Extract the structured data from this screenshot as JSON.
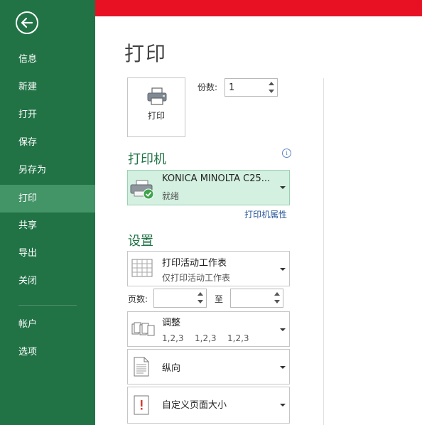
{
  "sidebar": {
    "items": [
      {
        "label": "信息"
      },
      {
        "label": "新建"
      },
      {
        "label": "打开"
      },
      {
        "label": "保存"
      },
      {
        "label": "另存为"
      },
      {
        "label": "打印"
      },
      {
        "label": "共享"
      },
      {
        "label": "导出"
      },
      {
        "label": "关闭"
      },
      {
        "label": "帐户"
      },
      {
        "label": "选项"
      }
    ],
    "active": "打印"
  },
  "page": {
    "title": "打印"
  },
  "print_button": {
    "label": "打印"
  },
  "copies": {
    "label": "份数:",
    "value": "1"
  },
  "printer": {
    "section_title": "打印机",
    "name": "KONICA MINOLTA C25...",
    "status": "就绪",
    "properties_link": "打印机属性"
  },
  "settings": {
    "section_title": "设置",
    "print_what": {
      "title": "打印活动工作表",
      "subtitle": "仅打印活动工作表"
    },
    "pages_label": "页数:",
    "to_label": "至",
    "collate": {
      "title": "调整",
      "sequence": [
        "1,2,3",
        "1,2,3",
        "1,2,3"
      ]
    },
    "orientation": {
      "title": "纵向"
    },
    "paper_size": {
      "title": "自定义页面大小"
    }
  },
  "colors": {
    "sidebar": "#217346",
    "active_item": "#439467",
    "topbar": "#e81123",
    "accent_text": "#217346"
  }
}
